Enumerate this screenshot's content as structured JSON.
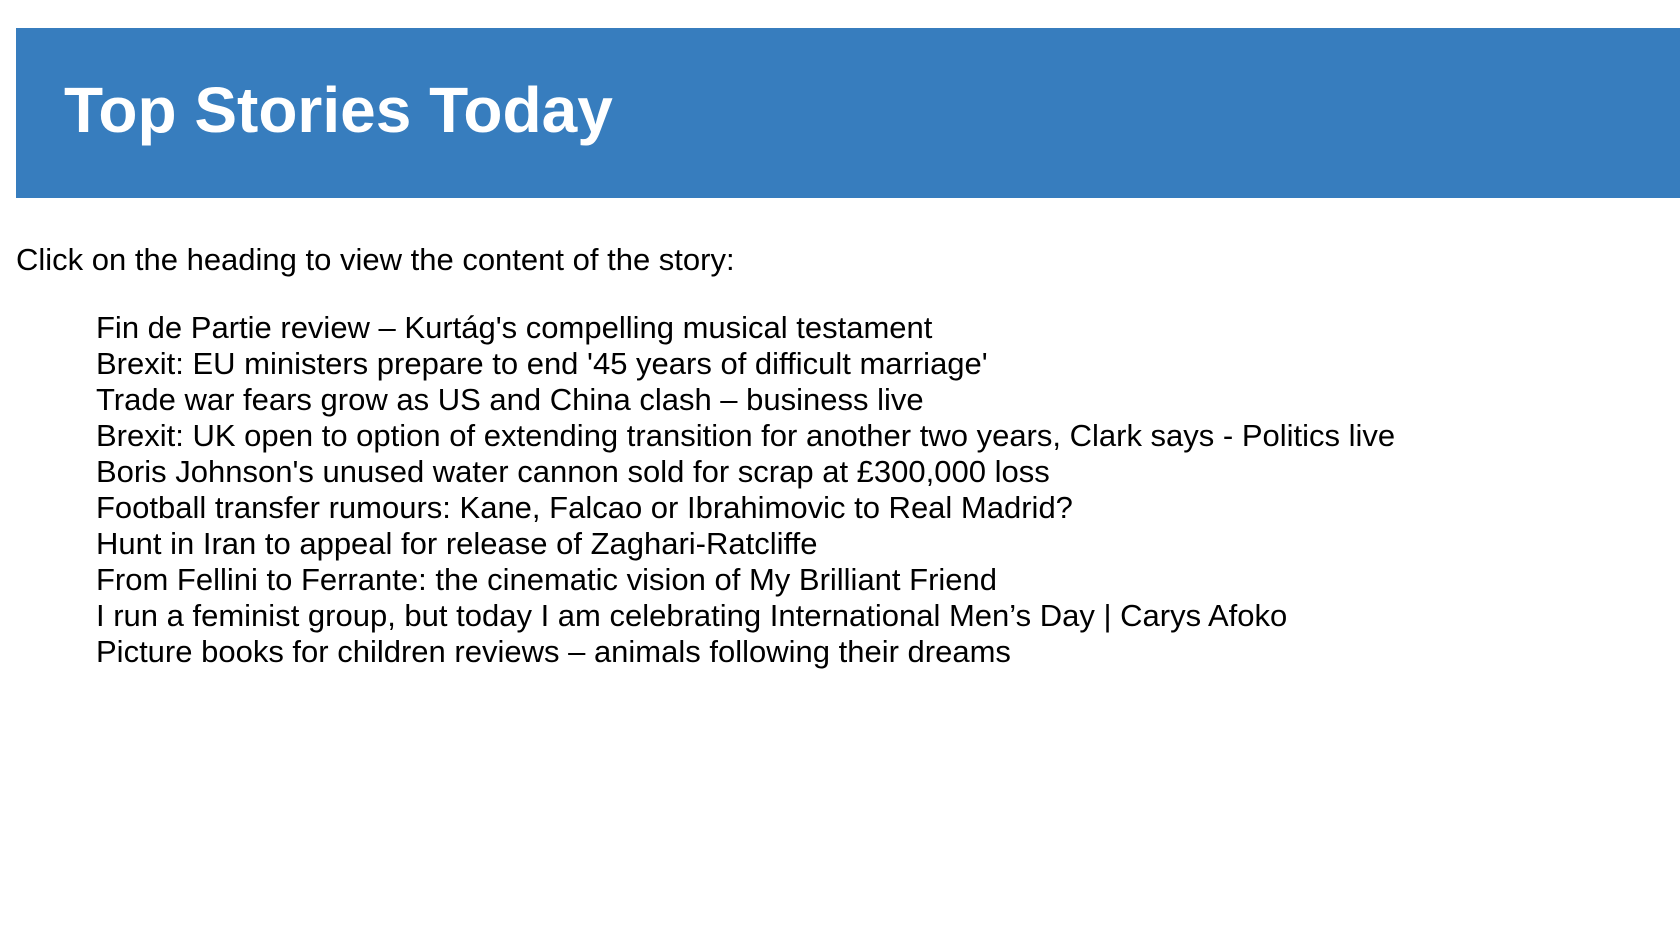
{
  "header": {
    "title": "Top Stories Today",
    "background_color": "#377dbe",
    "text_color": "#ffffff"
  },
  "intro": {
    "text": "Click on the heading to view the content of the story:"
  },
  "stories": [
    {
      "title": "Fin de Partie review – Kurtág's compelling musical testament"
    },
    {
      "title": "Brexit: EU ministers prepare to end '45 years of difficult marriage'"
    },
    {
      "title": "Trade war fears grow as US and China clash – business live"
    },
    {
      "title": "Brexit: UK open to option of extending transition for another two years, Clark says - Politics live"
    },
    {
      "title": "Boris Johnson's unused water cannon sold for scrap at £300,000 loss"
    },
    {
      "title": "Football transfer rumours: Kane, Falcao or Ibrahimovic to Real Madrid?"
    },
    {
      "title": "Hunt in Iran to appeal for release of Zaghari-Ratcliffe"
    },
    {
      "title": "From Fellini to Ferrante: the cinematic vision of My Brilliant Friend"
    },
    {
      "title": "I run a feminist group, but today I am celebrating International Men’s Day | Carys Afoko"
    },
    {
      "title": "Picture books for children reviews – animals following their dreams"
    }
  ]
}
